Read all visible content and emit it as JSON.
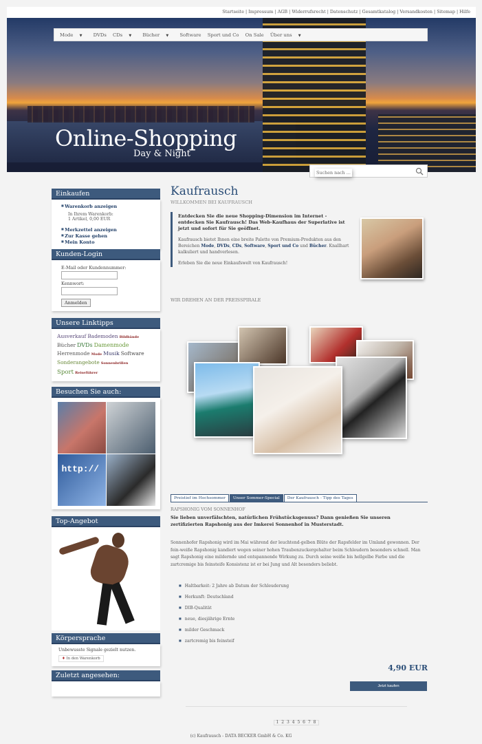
{
  "topbar": {
    "links": "Startseite | Impressum | AGB | Widerrufsrecht | Datenschutz | Gesamtkatalog | Versandkosten | Sitemap | Hilfe"
  },
  "nav": {
    "items": [
      "Mode",
      "DVDs",
      "CDs",
      "Bücher",
      "Software",
      "Sport und Co",
      "On Sale",
      "Über uns"
    ]
  },
  "hero": {
    "title": "Online-Shopping",
    "subtitle": "Day & Night"
  },
  "search": {
    "placeholder": "Suchen nach ..."
  },
  "sidebar": {
    "shop": {
      "title": "Einkaufen",
      "cart_link": "Warenkorb anzeigen",
      "cart_info_1": "In Ihrem Warenkorb:",
      "cart_info_2": "1 Artikel, 0,00 EUR",
      "links": [
        "Merkzettel anzeigen",
        "Zur Kasse gehen",
        "Mein Konto"
      ]
    },
    "login": {
      "title": "Kunden-Login",
      "email_label": "E-Mail oder Kundennummer:",
      "password_label": "Kennwort:",
      "button": "Anmelden"
    },
    "tags": {
      "title": "Unsere Linktipps",
      "items": [
        {
          "text": "Ausverkauf",
          "color": "#5a4a7a"
        },
        {
          "text": "Bademoden",
          "color": "#5a4a7a"
        },
        {
          "text": "Bildbände",
          "color": "#8a1f1f"
        },
        {
          "text": "Bücher",
          "color": "#555555"
        },
        {
          "text": "DVDs",
          "color": "#3a7a3a"
        },
        {
          "text": "Damenmode",
          "color": "#6a9a3a"
        },
        {
          "text": "Herrenmode",
          "color": "#555555"
        },
        {
          "text": "Mode",
          "color": "#8a1f1f"
        },
        {
          "text": "Musik",
          "color": "#3a3a6a"
        },
        {
          "text": "Software",
          "color": "#444444"
        },
        {
          "text": "Sonderangebote",
          "color": "#6a8a3a"
        },
        {
          "text": "Sonnenbrillen",
          "color": "#8a1f1f"
        },
        {
          "text": "Sport",
          "color": "#5a8a3a"
        },
        {
          "text": "Reiseführer",
          "color": "#8a1f1f"
        }
      ]
    },
    "visit": {
      "title": "Besuchen Sie auch:",
      "http_text": "http://"
    },
    "top_offer": {
      "title": "Top-Angebot"
    },
    "koerper": {
      "title": "Körpersprache",
      "text": "Unbewusste Signale gezielt nutzen.",
      "cart_button": "In den Warenkorb"
    },
    "recent": {
      "title": "Zuletzt angesehen:"
    }
  },
  "main": {
    "title": "Kaufrausch",
    "welcome": "WILLKOMMEN BEI KAUFRAUSCH",
    "intro_lead": "Entdecken Sie die neue Shopping-Dimension im Internet - entdecken Sie Kaufrausch! Das Web-Kaufhaus der Superlative ist jetzt und sofort für Sie geöffnet.",
    "intro_p1_a": "Kaufrausch bietet Ihnen eine breite Palette von Premium-Produkten aus den Bereichen ",
    "intro_p1_links": [
      "Mode",
      "DVDs",
      "CDs",
      "Software",
      "Sport und Co",
      "Bücher"
    ],
    "intro_p1_b": ". Knallhart kalkuliert und handverlesen.",
    "intro_p2": "Erleben Sie die neue Einkaufswelt von Kaufrausch!",
    "spiral": "WIR DREHEN AN DER PREISSPIRALE",
    "tabs": [
      "Preistief im Hochsommer",
      "Unser Sommer-Special",
      "Der Kaufrausch - Tipp des Tages"
    ],
    "tab_heading": "RAPSHONIG VOM SONNENHOF",
    "tab_lead": "Sie lieben unverfälschten, natürlichen Frühstücksgenuss? Dann genießen Sie unseren zertifizierten Rapshonig aus der Imkerei Sonnenhof in Musterstadt.",
    "tab_body": "Sonnenhofer Rapshonig wird im Mai während der leuchtend-gelben Blüte der Rapsfelder im Umland gewonnen. Der fein-weiße Rapshonig kandiert wegen seiner hohen Traubenzuckergehalter beim Schleudern besonders schnell. Man sagt Rapshonig eine mildernde und entspannende Wirkung zu. Durch seine weiße bis hellgelbe Farbe und die zartcremige bis feinsteife Konsistenz ist er bei Jung und Alt besonders beliebt.",
    "bullets": [
      "Haltbarkeit: 2 Jahre ab Datum der Schleuderung",
      "Herkunft: Deutschland",
      "DIB-Qualität",
      "neue, diesjährige Ernte",
      "milder Geschmack",
      "zartcremig bis feinsteif"
    ],
    "price": "4,90 EUR",
    "buy_button": "Jetzt kaufen"
  },
  "footer": {
    "pager": "1 2 3 4 5 6 7 8",
    "copyright": "(c) Kaufrausch - DATA BECKER GmbH & Co. KG"
  }
}
